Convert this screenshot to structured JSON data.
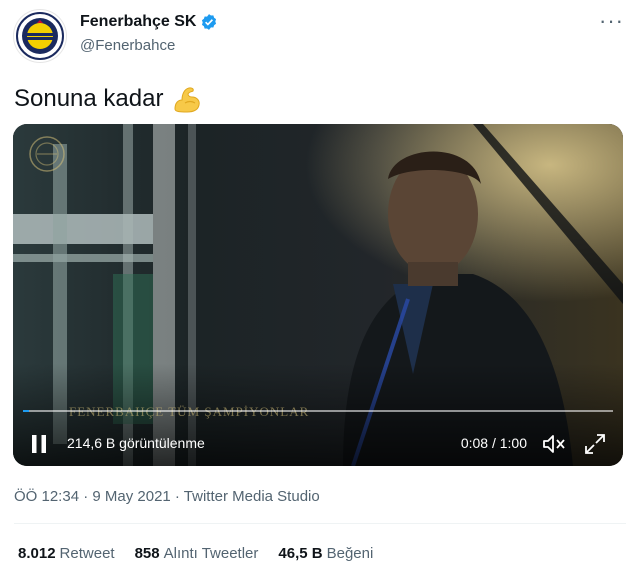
{
  "account": {
    "display_name": "Fenerbahçe SK",
    "handle": "@Fenerbahce",
    "avatar_icon": "fenerbahce-crest-icon",
    "verified_icon": "verified-badge-icon"
  },
  "tweet": {
    "text": "Sonuna kadar",
    "emoji_icon": "flexed-biceps-icon"
  },
  "video": {
    "views": "214,6 B görüntülenme",
    "time": "0:08 / 1:00",
    "progress": 0.01,
    "watermark": "FENERBAHÇE TÜM ŞAMPİYONLAR",
    "pause_icon": "pause-icon",
    "mute_icon": "volume-muted-icon",
    "expand_icon": "fullscreen-icon",
    "accent": "#1d9bf0"
  },
  "meta": {
    "timestamp": "ÖÖ 12:34 · 9 May 2021 · Twitter Media Studio"
  },
  "stats": [
    {
      "count": "8.012",
      "label": "Retweet"
    },
    {
      "count": "858",
      "label": "Alıntı Tweetler"
    },
    {
      "count": "46,5 B",
      "label": "Beğeni"
    }
  ],
  "more_icon": "more-options-icon"
}
